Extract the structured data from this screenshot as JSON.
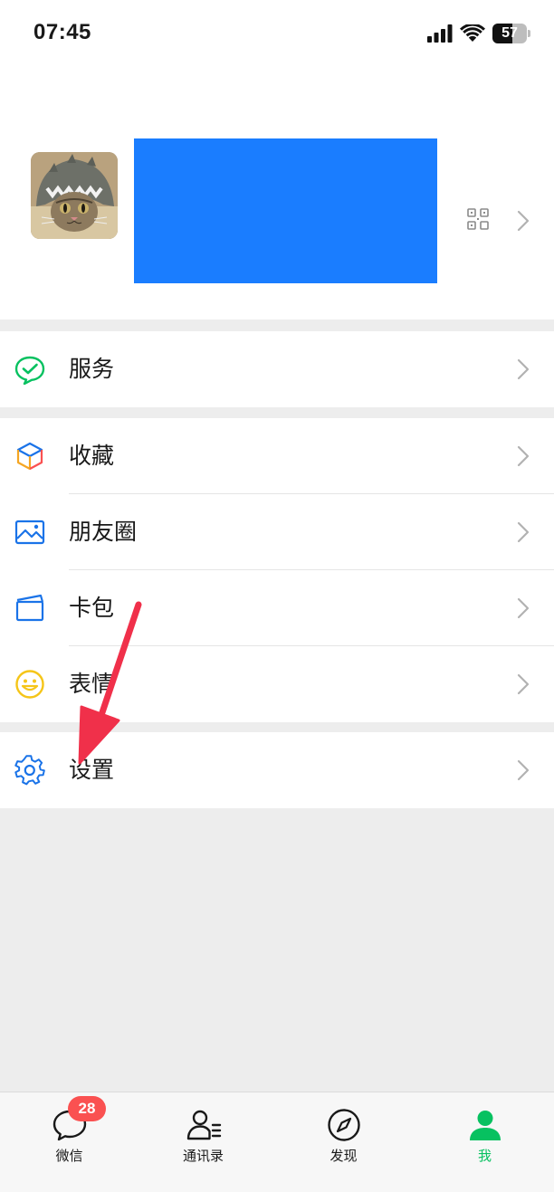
{
  "status_bar": {
    "time": "07:45",
    "battery": "57",
    "battery_level": 0.57,
    "icons": [
      "signal-icon",
      "wifi-icon",
      "battery-icon"
    ]
  },
  "profile": {
    "avatar": "avatar",
    "icons": [
      "qr-code-icon",
      "chevron-right-icon"
    ]
  },
  "menu": {
    "services": {
      "label": "服务",
      "icon": "services-icon",
      "color": "#07c160"
    },
    "favorites": {
      "label": "收藏",
      "icon": "favorites-icon"
    },
    "moments": {
      "label": "朋友圈",
      "icon": "moments-icon",
      "color": "#1a73e8"
    },
    "cards": {
      "label": "卡包",
      "icon": "card-wallet-icon",
      "color": "#1a73e8"
    },
    "stickers": {
      "label": "表情",
      "icon": "sticker-smiley-icon",
      "color": "#f5c518"
    },
    "settings": {
      "label": "设置",
      "icon": "settings-gear-icon",
      "color": "#1a73e8"
    }
  },
  "annotation": {
    "arrow_color": "#f0304a",
    "points_to": "settings"
  },
  "tabbar": {
    "tabs": [
      {
        "label": "微信",
        "icon": "chat-bubble-icon",
        "badge": "28"
      },
      {
        "label": "通讯录",
        "icon": "contacts-icon"
      },
      {
        "label": "发现",
        "icon": "compass-icon"
      },
      {
        "label": "我",
        "icon": "me-person-icon",
        "active": true
      }
    ],
    "active_color": "#07c160",
    "badge_color": "#fa5151"
  }
}
